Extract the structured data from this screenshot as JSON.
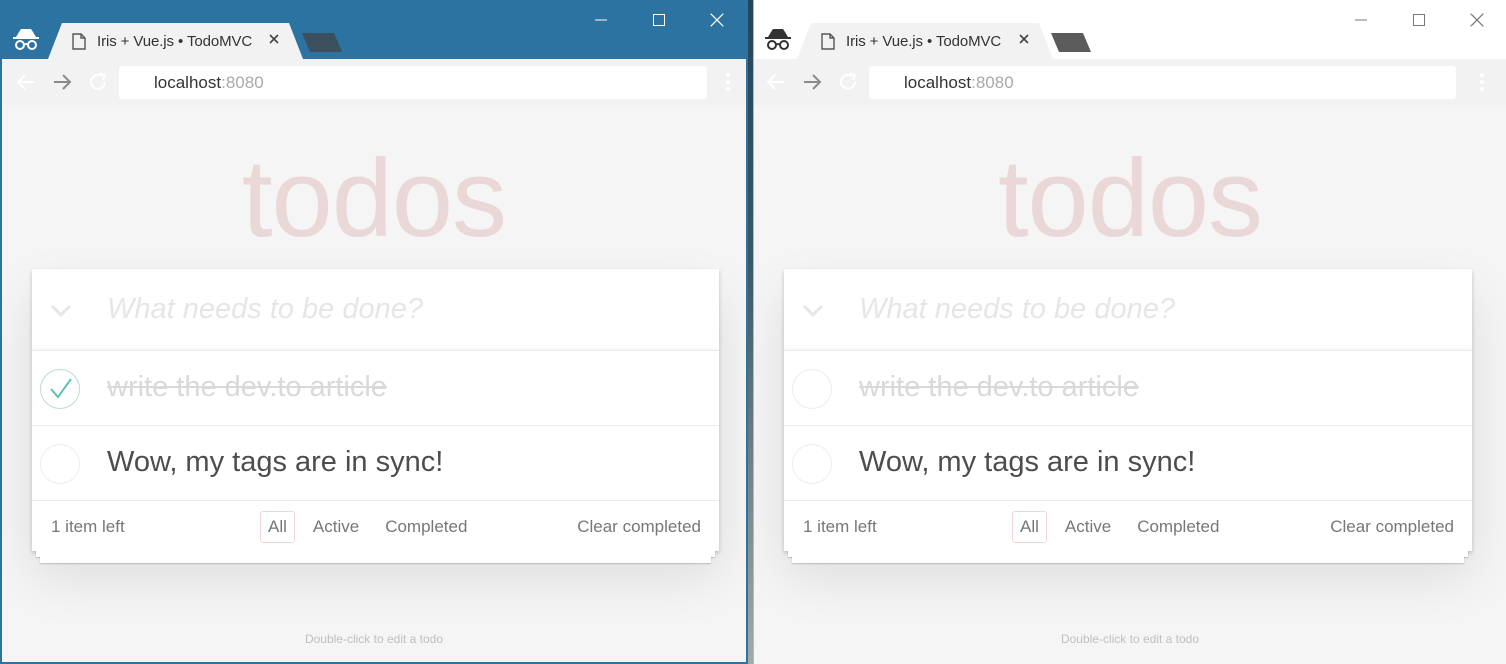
{
  "windows": [
    {
      "id": "left",
      "active": true,
      "tab": {
        "title": "Iris + Vue.js • TodoMVC"
      },
      "url": {
        "host": "localhost",
        "port": ":8080"
      },
      "app": {
        "title": "todos",
        "new_todo_placeholder": "What needs to be done?",
        "todos": [
          {
            "text": "write the dev.to article",
            "completed": true
          },
          {
            "text": "Wow, my tags are in sync!",
            "completed": false
          }
        ],
        "footer": {
          "count": "1 item left",
          "filters": [
            "All",
            "Active",
            "Completed"
          ],
          "selected_filter": "All",
          "clear": "Clear completed"
        },
        "info": "Double-click to edit a todo"
      }
    },
    {
      "id": "right",
      "active": false,
      "tab": {
        "title": "Iris + Vue.js • TodoMVC"
      },
      "url": {
        "host": "localhost",
        "port": ":8080"
      },
      "app": {
        "title": "todos",
        "new_todo_placeholder": "What needs to be done?",
        "todos": [
          {
            "text": "write the dev.to article",
            "completed": true
          },
          {
            "text": "Wow, my tags are in sync!",
            "completed": false
          }
        ],
        "footer": {
          "count": "1 item left",
          "filters": [
            "All",
            "Active",
            "Completed"
          ],
          "selected_filter": "All",
          "clear": "Clear completed"
        },
        "info": "Double-click to edit a todo"
      }
    }
  ],
  "colors": {
    "active_titlebar": "#2c73a1",
    "inactive_titlebar": "#ffffff",
    "toolbar": "#555555",
    "todos_title": "rgba(175,47,47,0.15)",
    "check_green": "#5dc2af"
  },
  "icons": [
    "incognito-icon",
    "doc-icon",
    "tab-close-icon",
    "minimize-icon",
    "maximize-icon",
    "close-icon",
    "back-icon",
    "forward-icon",
    "reload-icon",
    "info-icon",
    "star-icon",
    "menu-icon",
    "chevron-down-icon",
    "check-icon"
  ]
}
